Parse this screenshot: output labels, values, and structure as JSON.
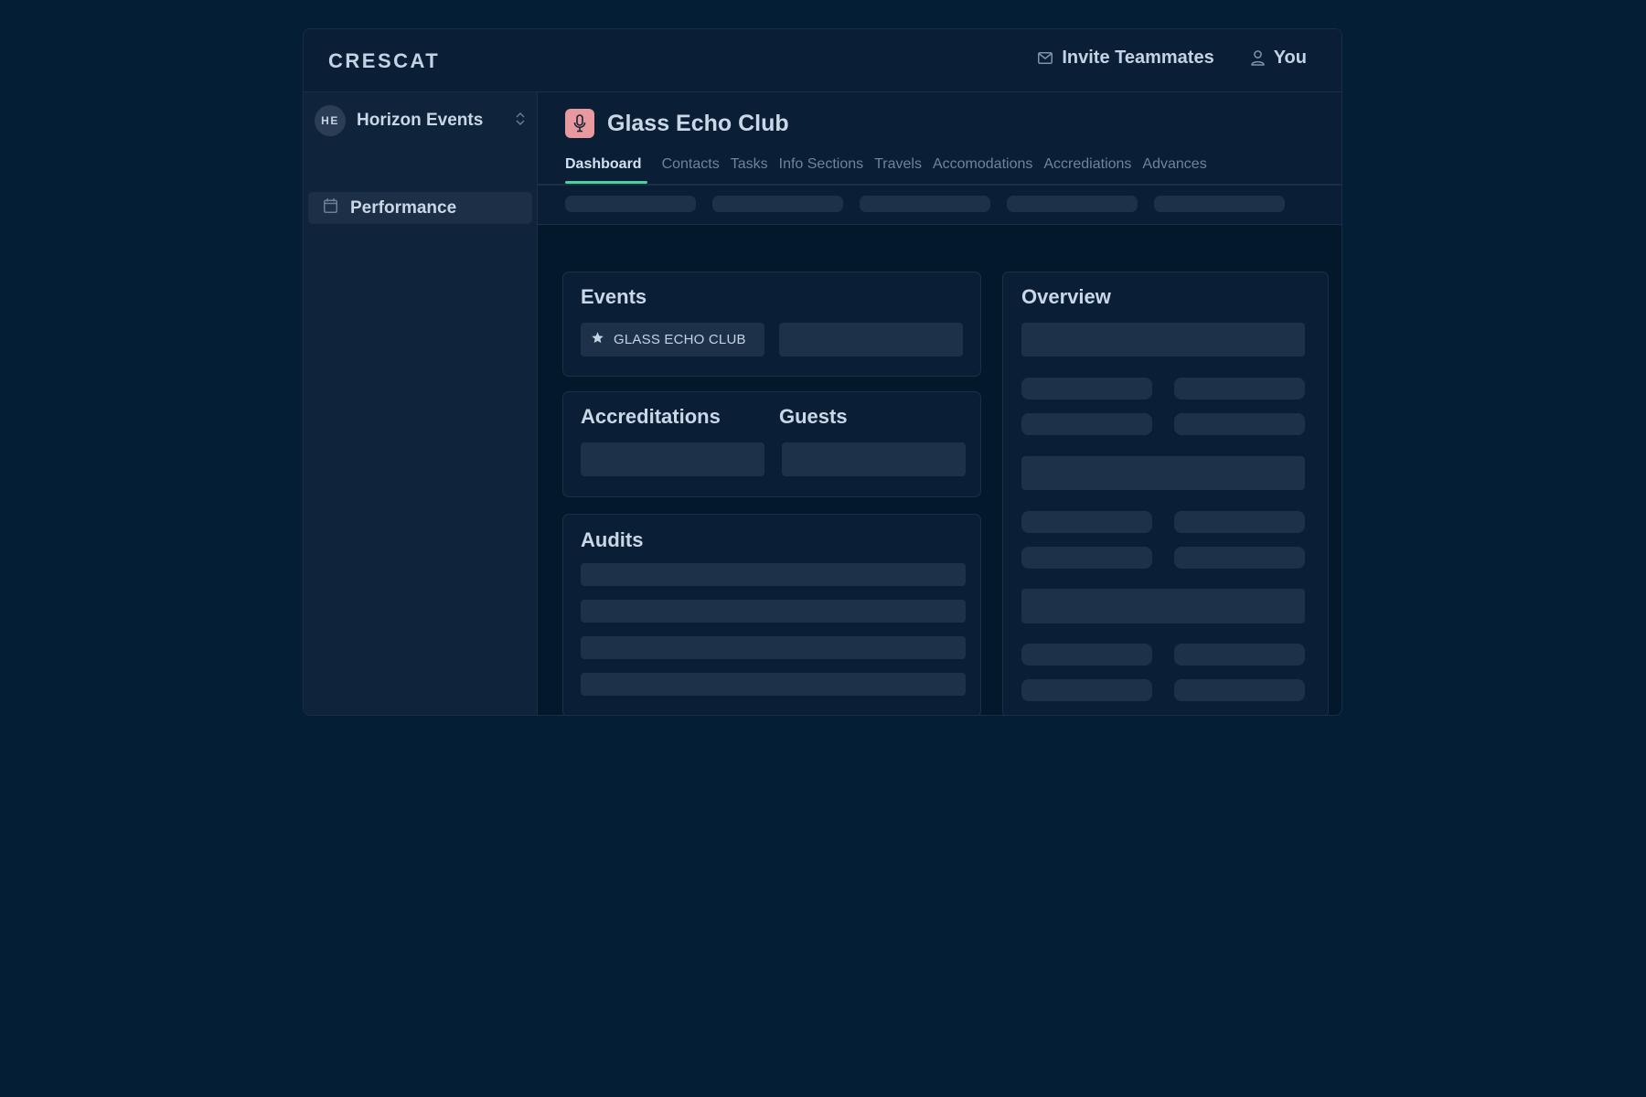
{
  "brand": "CRESCAT",
  "header": {
    "invite_label": "Invite Teammates",
    "invite_icon": "mail-icon",
    "user_label": "You",
    "user_icon": "user-icon"
  },
  "sidebar": {
    "org": {
      "initials": "HE",
      "name": "Horizon Events",
      "switch_icon": "chevron-up-down-icon"
    },
    "items": [
      {
        "label": "Performance",
        "icon": "calendar-icon",
        "active": true
      }
    ]
  },
  "page": {
    "title": "Glass Echo Club",
    "title_icon": "microphone-icon",
    "tabs": [
      {
        "label": "Dashboard",
        "active": true
      },
      {
        "label": "Contacts"
      },
      {
        "label": "Tasks"
      },
      {
        "label": "Info Sections"
      },
      {
        "label": "Travels"
      },
      {
        "label": "Accomodations"
      },
      {
        "label": "Accrediations"
      },
      {
        "label": "Advances"
      }
    ]
  },
  "cards": {
    "events": {
      "title": "Events",
      "chip": {
        "label": "GLASS ECHO CLUB",
        "icon": "star-icon"
      }
    },
    "accreditations": {
      "title": "Accreditations"
    },
    "guests": {
      "title": "Guests"
    },
    "audits": {
      "title": "Audits"
    },
    "overview": {
      "title": "Overview"
    }
  },
  "colors": {
    "accent": "#4fd09a",
    "title_icon_bg": "#e8999f",
    "page_bg": "#041f35",
    "panel_bg": "#0a1f36",
    "skeleton": "#1d3148"
  }
}
